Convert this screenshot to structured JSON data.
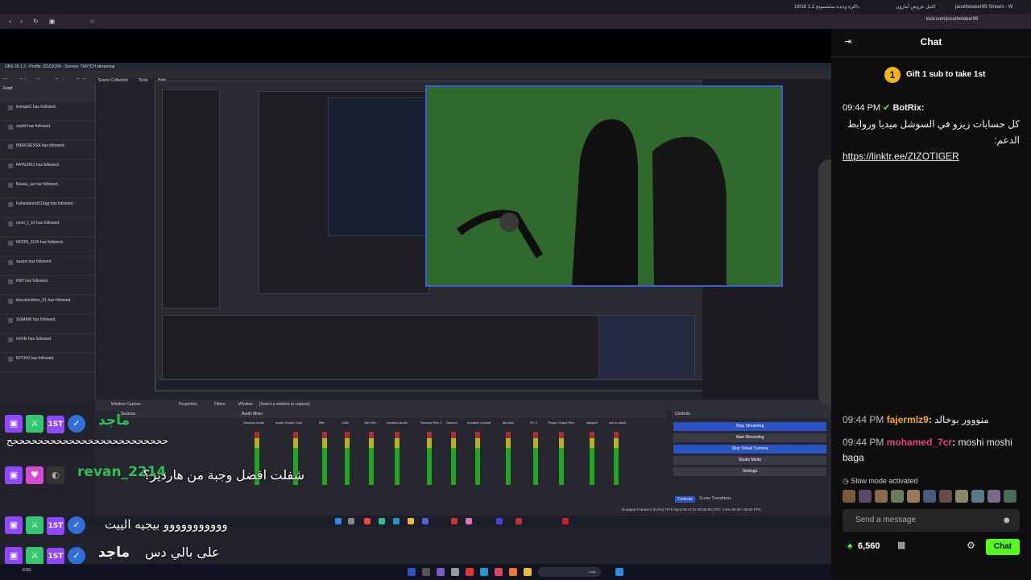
{
  "browser": {
    "tabs": [
      {
        "label": "كامل عروض أمازون"
      },
      {
        "label": "jaosthetaker99 Stream - W"
      },
      {
        "label": "18/16 ذاكرة وحدة سامسونج 1.1"
      }
    ],
    "url": "kick.com/josothetaker99"
  },
  "obs": {
    "title": "OBS 29.1.2 - Profile: ZOZZO99 - Scenes: TWITCH streaming",
    "menu": [
      "File",
      "Edit",
      "View",
      "Docks",
      "Profile",
      "Scene Collection",
      "Tools",
      "Help"
    ],
    "feed_title": "Feed",
    "feed_items": [
      "ilsmajid1 has followed.",
      "oiazlit has followed.",
      "IBRA10ESSA has followed.",
      "FAYEZ811 has followed.",
      "Basaa_aa has followed.",
      "Fahadalanzi616qg has followed.",
      "omer_f_16 has followed.",
      "NOON_1100 has followed.",
      "zaazw has followed.",
      "IlNH has followed.",
      "thecolombien_01 has followed.",
      "SGMAW has followed.",
      "mt24k has followed.",
      "N7CKR has followed."
    ],
    "window_capture": "Window Capture",
    "properties": "Properties",
    "filters": "Filters",
    "window_label": "Window",
    "window_select": "[Select a window to capture]",
    "sources_title": "Sources",
    "mixer_title": "Audio Mixer",
    "controls_title": "Controls",
    "mixer_channels": [
      "Desktop Audio",
      "Audio Output Capt",
      "Bits",
      "CAM",
      "Dec Rec",
      "Desktop Audio",
      "Desktop Rec 2",
      "Discord",
      "donation youself",
      "Mic/Aux",
      "PC 2",
      "Player Output Rec",
      "stinger2",
      "sub & raush"
    ],
    "controls": {
      "stop_streaming": "Stop Streaming",
      "start_recording": "Start Recording",
      "stop_virtual_camera": "Stop Virtual Camera",
      "studio_mode": "Studio Mode",
      "settings": "Settings"
    },
    "tabs": [
      "Controls",
      "Scene Transitions"
    ],
    "status": "Dropped Frames 0 (0.0%)   7976 kbps   00:47:52   00:00:00   CPU: 3.5%   60.00 / 60.00 FPS"
  },
  "overlay": {
    "lines": [
      {
        "name": "ماجد",
        "name_color": "#27c45a",
        "message": "حححححححححححححححححححححححححح"
      },
      {
        "name": "revan_2214",
        "name_color": "#2fbf59",
        "message": "شفلت افضل وجبة من  هارديز؟"
      },
      {
        "name": "ماجد",
        "name_color": "#27c45a",
        "message": "ووووووووووو بيجيه الييت"
      },
      {
        "name": "ماجد",
        "name_color": "#ffffff",
        "message": "على بالي دس"
      }
    ]
  },
  "chat": {
    "title": "Chat",
    "gift_text": "Gift 1 sub to take 1st",
    "pinned": {
      "time": "09:44 PM",
      "user": "BotRix",
      "text": "كل حسابات زيزو في السوشل ميديا وروابط الدعم:",
      "link": "https://linktr.ee/ZIZOTIGER"
    },
    "messages": [
      {
        "time": "09:44 PM",
        "user": "fajermlz9",
        "user_color": "#f5a623",
        "text": "منووور بوخالد"
      },
      {
        "time": "09:44 PM",
        "user": "mohamed_7cr",
        "user_color": "#e8436b",
        "text": "moshi moshi baga"
      }
    ],
    "slow_mode": "Slow mode activated",
    "send_placeholder": "Send a message",
    "points": "6,560",
    "chat_button": "Chat"
  },
  "taskbar": {
    "search": "بحث",
    "lang": "ENG"
  }
}
